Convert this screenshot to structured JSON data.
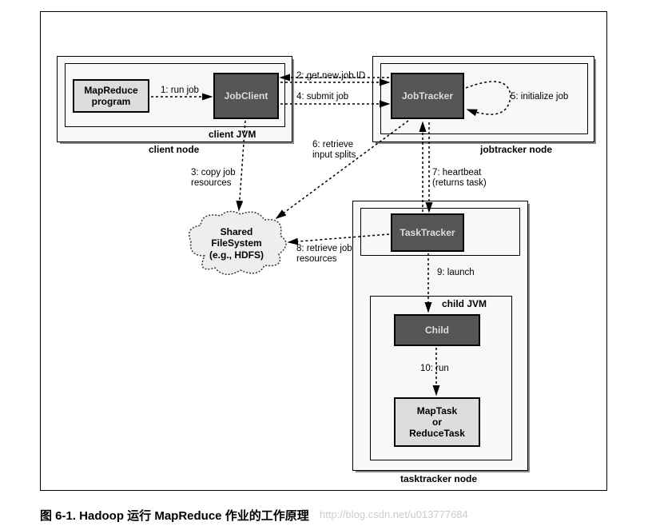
{
  "caption": "图 6-1.  Hadoop 运行 MapReduce 作业的工作原理",
  "watermark": "http://blog.csdn.net/u013777684",
  "nodes": {
    "client_node": {
      "label": "client node"
    },
    "jobtracker_node": {
      "label": "jobtracker node"
    },
    "tasktracker_node": {
      "label": "tasktracker node"
    },
    "client_jvm": {
      "label": "client JVM"
    },
    "child_jvm": {
      "label": "child JVM"
    }
  },
  "components": {
    "mapreduce_program": "MapReduce\nprogram",
    "jobclient": "JobClient",
    "jobtracker": "JobTracker",
    "tasktracker": "TaskTracker",
    "child": "Child",
    "maptask": "MapTask\nor\nReduceTask",
    "shared_fs": "Shared\nFileSystem\n(e.g., HDFS)"
  },
  "edges": {
    "e1": "1: run job",
    "e2": "2: get new job ID",
    "e3": "3: copy job\nresources",
    "e4": "4: submit job",
    "e5": "5: initialize job",
    "e6": "6: retrieve\ninput splits",
    "e7": "7: heartbeat\n(returns task)",
    "e8": "8: retrieve job\nresources",
    "e9": "9: launch",
    "e10": "10: run"
  }
}
